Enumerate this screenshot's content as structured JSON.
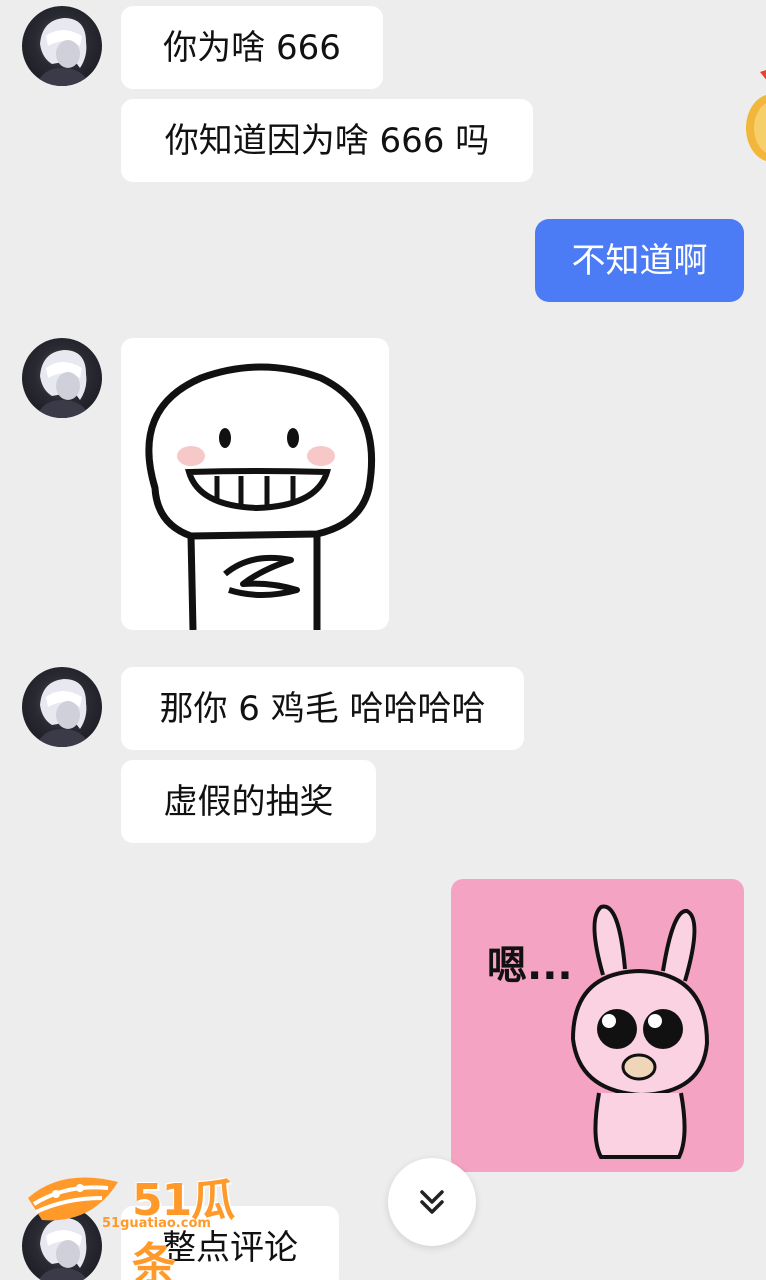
{
  "messages": {
    "m1": "你为啥 666",
    "m2": "你知道因为啥 666 吗",
    "m3": "不知道啊",
    "m5": "那你 6 鸡毛 哈哈哈哈",
    "m6": "虚假的抽奖",
    "m8": "整点评论"
  },
  "sticker_bunny": {
    "text": "嗯..."
  },
  "watermark": {
    "brand": "51瓜条",
    "domain": "51guatiao.com"
  },
  "colors": {
    "background": "#ededee",
    "incoming_bubble": "#ffffff",
    "outgoing_bubble": "#4b7bf5",
    "sticker_pink": "#f5a3c2",
    "watermark": "#ff9a2a"
  },
  "icons": {
    "scroll_button": "double-chevron-down-icon"
  }
}
